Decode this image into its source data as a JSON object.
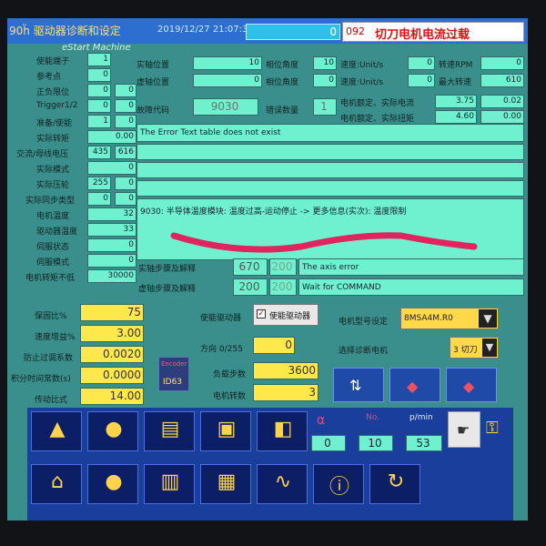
{
  "window": {
    "title": "90ḧ 驱动器诊断和设定",
    "datetime": "2019/12/27 21:07:35",
    "alarm_count": "0",
    "alarm_code": "092",
    "alarm_text": "切刀电机电流过载",
    "subtitle": "eStart Machine"
  },
  "left": [
    {
      "label": "使能端子",
      "v1": "1",
      "v2": ""
    },
    {
      "label": "参考点",
      "v1": "0",
      "v2": ""
    },
    {
      "label": "正负限位",
      "v1": "0",
      "v2": "0"
    },
    {
      "label": "Trigger1/2",
      "v1": "0",
      "v2": "0"
    },
    {
      "label": "准备/使能",
      "v1": "1",
      "v2": "0"
    },
    {
      "label": "实际转矩",
      "v1": "0.00",
      "v2": ""
    },
    {
      "label": "交流/母线电压",
      "v1": "435",
      "v2": "616"
    },
    {
      "label": "实际模式",
      "v1": "0",
      "v2": ""
    },
    {
      "label": "实际压轮",
      "v1": "255",
      "v2": "0"
    },
    {
      "label": "实际同步类型",
      "v1": "0",
      "v2": "0"
    },
    {
      "label": "电机温度",
      "v1": "32",
      "v2": ""
    },
    {
      "label": "驱动器温度",
      "v1": "33",
      "v2": ""
    },
    {
      "label": "伺服状态",
      "v1": "0",
      "v2": ""
    },
    {
      "label": "伺服模式",
      "v1": "0",
      "v2": ""
    },
    {
      "label": "电机转矩不低",
      "v1": "30000",
      "v2": ""
    }
  ],
  "positions": {
    "actual_pos_label": "实轴位置",
    "actual_pos": "10",
    "virtual_pos_label": "虚轴位置",
    "virtual_pos": "0",
    "phase_label": "相位角度",
    "phase1": "10",
    "phase2": "0",
    "speed_label": "速度:Unit/s",
    "speed1": "0",
    "speed2": "0",
    "rpm_label": "转速RPM",
    "rpm": "0",
    "max_speed_label": "最大转速",
    "max_speed": "610",
    "rated_current_label": "电机额定、实际电流",
    "rated_current": "3.75",
    "actual_current": "0.02",
    "rated_torque_label": "电机额定、实际扭矩",
    "rated_torque": "4.60",
    "actual_torque": "0.00",
    "fault_code_label": "故障代码",
    "fault_code": "9030",
    "error_count_label": "错误数量",
    "error_count": "1"
  },
  "errors": {
    "line1": "The Error Text table does not exist",
    "line2": "9030: 半导体温度模块: 温度过高-运动停止 -> 更多信息(实次): 温度限制"
  },
  "steps": {
    "actual_label": "实轴步骤及解释",
    "actual_step": "670",
    "actual_step2": "200",
    "actual_text": "The axis error",
    "virtual_label": "虚轴步骤及解释",
    "virtual_step": "200",
    "virtual_step2": "200",
    "virtual_text": "Wait for COMMAND"
  },
  "params": [
    {
      "label": "保固比%",
      "value": "75"
    },
    {
      "label": "速度增益%",
      "value": "3.00"
    },
    {
      "label": "防止过调系数",
      "value": "0.0020"
    },
    {
      "label": "积分时间常数(s)",
      "value": "0.0000"
    },
    {
      "label": "传动比式",
      "value": "14.00"
    }
  ],
  "drive": {
    "enable_label": "使能驱动器",
    "enable_button": "使能驱动器",
    "motor_type_label": "电机型号设定",
    "motor_type": "8MSA4M.R0",
    "direction_label": "方向 0/255",
    "direction": "0",
    "diag_motor_label": "选择诊断电机",
    "diag_motor": "3   切刀",
    "load_steps_label": "负载步数",
    "load_steps": "3600",
    "motor_rev_label": "电机转数",
    "motor_rev": "3",
    "encoder_id": "ID63"
  },
  "footer": {
    "counter1": "0",
    "counter2": "10",
    "counter3": "53",
    "unit_label": "p/min",
    "no_label": "No."
  }
}
